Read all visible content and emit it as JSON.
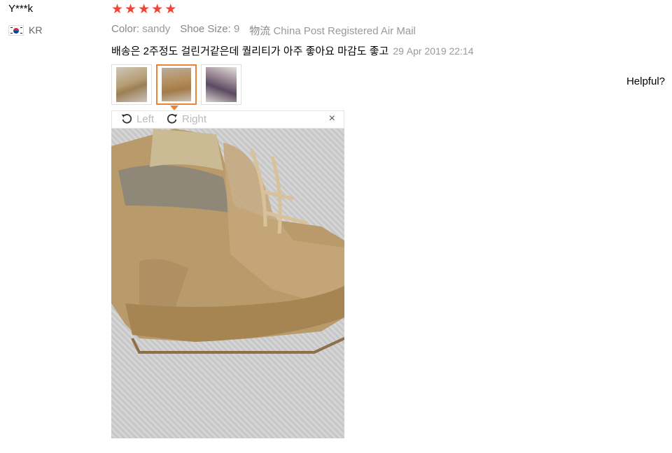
{
  "reviewer": {
    "name": "Y***k",
    "country": "KR",
    "flag_icon": "korea-flag-icon"
  },
  "rating": {
    "stars": 5,
    "max": 5,
    "color": "#f44336"
  },
  "attributes": {
    "color_label": "Color:",
    "color_value": "sandy",
    "size_label": "Shoe Size:",
    "size_value": "9",
    "logistics_label": "物流",
    "logistics_value": "China Post Registered Air Mail"
  },
  "review": {
    "text": "배송은 2주정도 걸린거같은데 퀄리티가 아주 좋아요 마감도 좋고",
    "time": "29 Apr 2019 22:14"
  },
  "thumbnails": [
    {
      "selected": false
    },
    {
      "selected": true
    },
    {
      "selected": false
    }
  ],
  "viewer": {
    "rotate_left": "Left",
    "rotate_right": "Right",
    "close_symbol": "×"
  },
  "helpful": "Helpful?",
  "accent_color": "#e8843a"
}
